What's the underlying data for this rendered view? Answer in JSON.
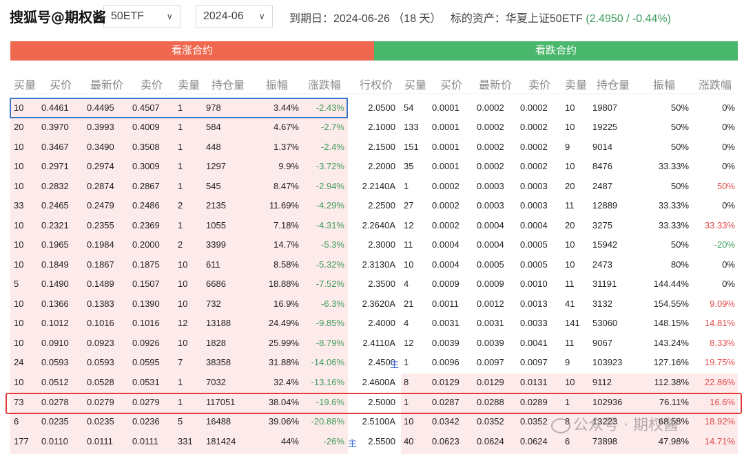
{
  "watermark_top": "搜狐号@期权酱",
  "selects": {
    "underlying": "50ETF",
    "month": "2024-06"
  },
  "expiry": {
    "label": "到期日：2024-06-26 （18 天）",
    "underlying_label": "标的资产：华夏上证50ETF",
    "price": "(2.4950 / -0.44%)"
  },
  "bands": {
    "call": "看涨合约",
    "put": "看跌合约"
  },
  "call_headers": [
    "买量",
    "买价",
    "最新价",
    "卖价",
    "卖量",
    "持仓量",
    "振幅",
    "涨跌幅"
  ],
  "put_headers": [
    "行权价",
    "买量",
    "买价",
    "最新价",
    "卖价",
    "卖量",
    "持仓量",
    "振幅",
    "涨跌幅"
  ],
  "rows": [
    {
      "c": [
        "10",
        "0.4461",
        "0.4495",
        "0.4507",
        "1",
        "978",
        "3.44%",
        "-2.43%"
      ],
      "strike": "2.0500",
      "p": [
        "54",
        "0.0001",
        "0.0002",
        "0.0002",
        "10",
        "19807",
        "50%",
        "0%"
      ],
      "pc": "black"
    },
    {
      "c": [
        "20",
        "0.3970",
        "0.3993",
        "0.4009",
        "1",
        "584",
        "4.67%",
        "-2.7%"
      ],
      "strike": "2.1000",
      "p": [
        "133",
        "0.0001",
        "0.0002",
        "0.0002",
        "10",
        "19225",
        "50%",
        "0%"
      ],
      "pc": "black"
    },
    {
      "c": [
        "10",
        "0.3467",
        "0.3490",
        "0.3508",
        "1",
        "448",
        "1.37%",
        "-2.4%"
      ],
      "strike": "2.1500",
      "p": [
        "151",
        "0.0001",
        "0.0002",
        "0.0002",
        "9",
        "9014",
        "50%",
        "0%"
      ],
      "pc": "black"
    },
    {
      "c": [
        "10",
        "0.2971",
        "0.2974",
        "0.3009",
        "1",
        "1297",
        "9.9%",
        "-3.72%"
      ],
      "strike": "2.2000",
      "p": [
        "35",
        "0.0001",
        "0.0002",
        "0.0002",
        "10",
        "8476",
        "33.33%",
        "0%"
      ],
      "pc": "black"
    },
    {
      "c": [
        "10",
        "0.2832",
        "0.2874",
        "0.2867",
        "1",
        "545",
        "8.47%",
        "-2.94%"
      ],
      "strike": "2.2140A",
      "p": [
        "1",
        "0.0002",
        "0.0003",
        "0.0003",
        "20",
        "2487",
        "50%",
        "50%"
      ],
      "pc": "red"
    },
    {
      "c": [
        "33",
        "0.2465",
        "0.2479",
        "0.2486",
        "2",
        "2135",
        "11.69%",
        "-4.29%"
      ],
      "strike": "2.2500",
      "p": [
        "27",
        "0.0002",
        "0.0003",
        "0.0003",
        "11",
        "12889",
        "33.33%",
        "0%"
      ],
      "pc": "black"
    },
    {
      "c": [
        "10",
        "0.2321",
        "0.2355",
        "0.2369",
        "1",
        "1055",
        "7.18%",
        "-4.31%"
      ],
      "strike": "2.2640A",
      "p": [
        "12",
        "0.0002",
        "0.0004",
        "0.0004",
        "20",
        "3275",
        "33.33%",
        "33.33%"
      ],
      "pc": "red"
    },
    {
      "c": [
        "10",
        "0.1965",
        "0.1984",
        "0.2000",
        "2",
        "3399",
        "14.7%",
        "-5.3%"
      ],
      "strike": "2.3000",
      "p": [
        "11",
        "0.0004",
        "0.0004",
        "0.0005",
        "10",
        "15942",
        "50%",
        "-20%"
      ],
      "pc": "green"
    },
    {
      "c": [
        "10",
        "0.1849",
        "0.1867",
        "0.1875",
        "10",
        "611",
        "8.58%",
        "-5.32%"
      ],
      "strike": "2.3130A",
      "p": [
        "10",
        "0.0004",
        "0.0005",
        "0.0005",
        "10",
        "2473",
        "80%",
        "0%"
      ],
      "pc": "black"
    },
    {
      "c": [
        "5",
        "0.1490",
        "0.1489",
        "0.1507",
        "10",
        "6686",
        "18.88%",
        "-7.52%"
      ],
      "strike": "2.3500",
      "p": [
        "4",
        "0.0009",
        "0.0009",
        "0.0010",
        "11",
        "31191",
        "144.44%",
        "0%"
      ],
      "pc": "black"
    },
    {
      "c": [
        "10",
        "0.1366",
        "0.1383",
        "0.1390",
        "10",
        "732",
        "16.9%",
        "-6.3%"
      ],
      "strike": "2.3620A",
      "p": [
        "21",
        "0.0011",
        "0.0012",
        "0.0013",
        "41",
        "3132",
        "154.55%",
        "9.09%"
      ],
      "pc": "red"
    },
    {
      "c": [
        "10",
        "0.1012",
        "0.1016",
        "0.1016",
        "12",
        "13188",
        "24.49%",
        "-9.85%"
      ],
      "strike": "2.4000",
      "p": [
        "4",
        "0.0031",
        "0.0031",
        "0.0033",
        "141",
        "53060",
        "148.15%",
        "14.81%"
      ],
      "pc": "red"
    },
    {
      "c": [
        "10",
        "0.0910",
        "0.0923",
        "0.0926",
        "10",
        "1828",
        "25.99%",
        "-8.79%"
      ],
      "strike": "2.4110A",
      "p": [
        "12",
        "0.0039",
        "0.0039",
        "0.0041",
        "11",
        "9067",
        "143.24%",
        "8.33%"
      ],
      "pc": "red"
    },
    {
      "c": [
        "24",
        "0.0593",
        "0.0593",
        "0.0595",
        "7",
        "38358",
        "31.88%",
        "-14.06%"
      ],
      "strike": "2.4500",
      "p": [
        "1",
        "0.0096",
        "0.0097",
        "0.0097",
        "9",
        "103923",
        "127.16%",
        "19.75%"
      ],
      "pc": "red"
    },
    {
      "c": [
        "10",
        "0.0512",
        "0.0528",
        "0.0531",
        "1",
        "7032",
        "32.4%",
        "-13.16%"
      ],
      "strike": "2.4600A",
      "p": [
        "8",
        "0.0129",
        "0.0129",
        "0.0131",
        "10",
        "9112",
        "112.38%",
        "22.86%"
      ],
      "pc": "red"
    },
    {
      "c": [
        "73",
        "0.0278",
        "0.0279",
        "0.0279",
        "1",
        "117051",
        "38.04%",
        "-19.6%"
      ],
      "strike": "2.5000",
      "p": [
        "1",
        "0.0287",
        "0.0288",
        "0.0289",
        "1",
        "102936",
        "76.11%",
        "16.6%"
      ],
      "pc": "red"
    },
    {
      "c": [
        "6",
        "0.0235",
        "0.0235",
        "0.0236",
        "5",
        "16488",
        "39.06%",
        "-20.88%"
      ],
      "strike": "2.5100A",
      "p": [
        "10",
        "0.0342",
        "0.0352",
        "0.0352",
        "8",
        "13223",
        "68.58%",
        "18.92%"
      ],
      "pc": "red"
    },
    {
      "c": [
        "177",
        "0.0110",
        "0.0111",
        "0.0111",
        "331",
        "181424",
        "44%",
        "-26%"
      ],
      "strike": "2.5500",
      "p": [
        "40",
        "0.0623",
        "0.0624",
        "0.0624",
        "6",
        "73898",
        "47.98%",
        "14.71%"
      ],
      "pc": "red"
    }
  ],
  "zhu_marker": "主",
  "watermark_bottom": "公众号 · 期权酱"
}
